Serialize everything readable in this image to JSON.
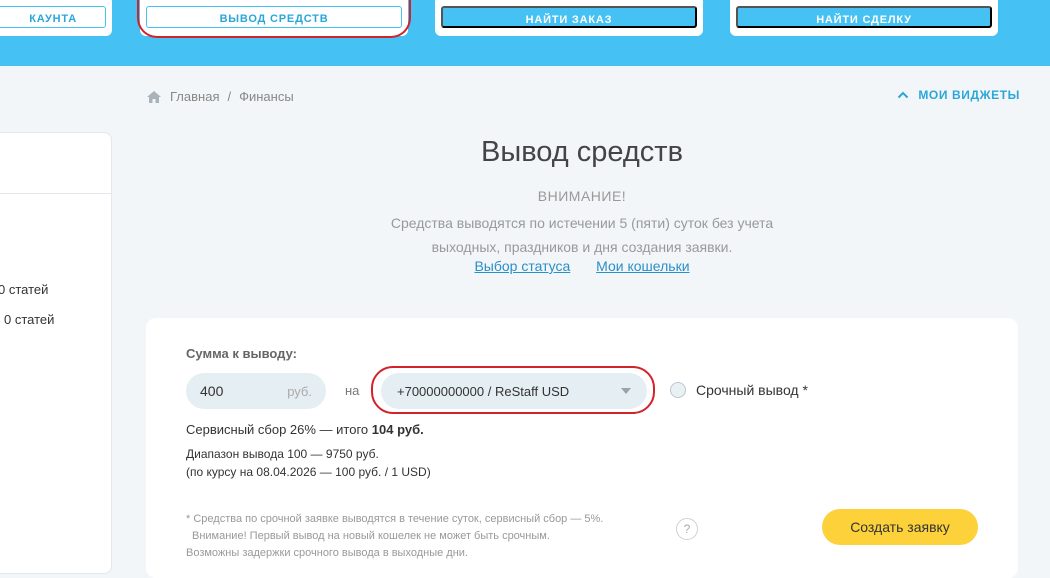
{
  "topnav": {
    "account_label": "кАУНТА",
    "withdraw_label": "ВЫВОД СРЕДСТВ",
    "find_order_label": "НАЙТИ ЗАКАЗ",
    "find_deal_label": "НАЙТИ СДЕЛКУ"
  },
  "sidebar": {
    "item1": "0 статей",
    "item2": "0 статей"
  },
  "breadcrumb": {
    "home": "Главная",
    "separator": "/",
    "current": "Финансы"
  },
  "widgets": {
    "label": "МОИ ВИДЖЕТЫ",
    "icon": "chevron-up-icon"
  },
  "page": {
    "title": "Вывод средств",
    "notice_heading": "ВНИМАНИЕ!",
    "notice_line1": "Средства выводятся по истечении 5 (пяти) суток без учета",
    "notice_line2": "выходных, праздников и дня создания заявки.",
    "link_status": "Выбор статуса",
    "link_wallets": "Мои кошельки"
  },
  "form": {
    "amount_label": "Сумма к выводу:",
    "amount_value": "400",
    "currency": "руб.",
    "to_label": "на",
    "wallet_selected": "+70000000000 / ReStaff USD",
    "urgent_label": "Срочный вывод *",
    "fee_text": "Сервисный сбор 26% — итого ",
    "fee_total": "104 руб.",
    "range_line1": "Диапазон вывода 100 — 9750 руб.",
    "range_line2": "(по курсу на 08.04.2026 — 100 руб. / 1 USD)",
    "footnote_line1": "* Средства по срочной заявке выводятся в течение суток, сервисный сбор — 5%.",
    "footnote_line2": "Внимание! Первый вывод на новый кошелек не может быть срочным.",
    "footnote_line3": "Возможны задержки срочного вывода в выходные дни.",
    "help_symbol": "?",
    "submit_label": "Создать заявку"
  },
  "colors": {
    "brand_blue": "#45c1f4",
    "accent_yellow": "#fcd13a",
    "highlight_red": "#d2232a"
  }
}
